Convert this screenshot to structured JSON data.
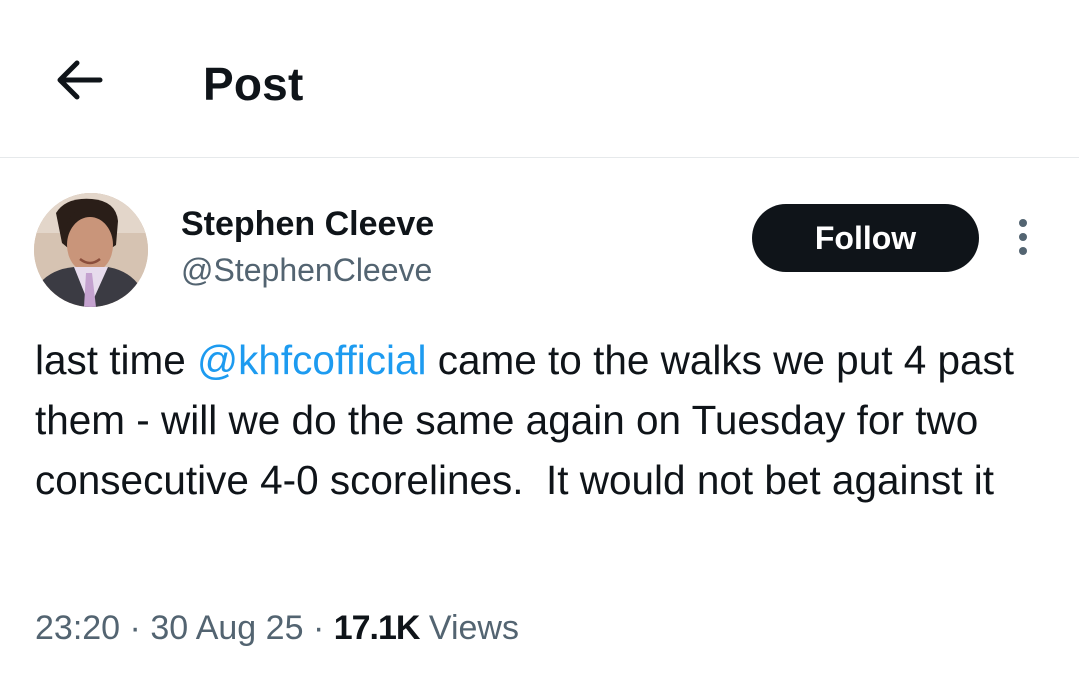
{
  "header": {
    "title": "Post",
    "back_icon": "arrow-left-icon"
  },
  "post": {
    "author": {
      "name": "Stephen Cleeve",
      "handle": "@StephenCleeve",
      "avatar": "profile-photo"
    },
    "follow_label": "Follow",
    "more_icon": "more-vertical-icon",
    "text": {
      "before": "last time ",
      "mention": "@khfcofficial",
      "after": " came to the walks we put 4 past them - will we do the same again on Tuesday for two consecutive 4-0 scorelines.  It would not bet against it"
    },
    "meta": {
      "time": "23:20",
      "separator": "·",
      "date": "30 Aug 25",
      "views_count": "17.1K",
      "views_label": "Views"
    }
  },
  "colors": {
    "text_primary": "#0f1419",
    "text_secondary": "#536471",
    "link": "#1d9bf0",
    "follow_bg": "#0f1419",
    "divider": "#e6e9eb"
  }
}
